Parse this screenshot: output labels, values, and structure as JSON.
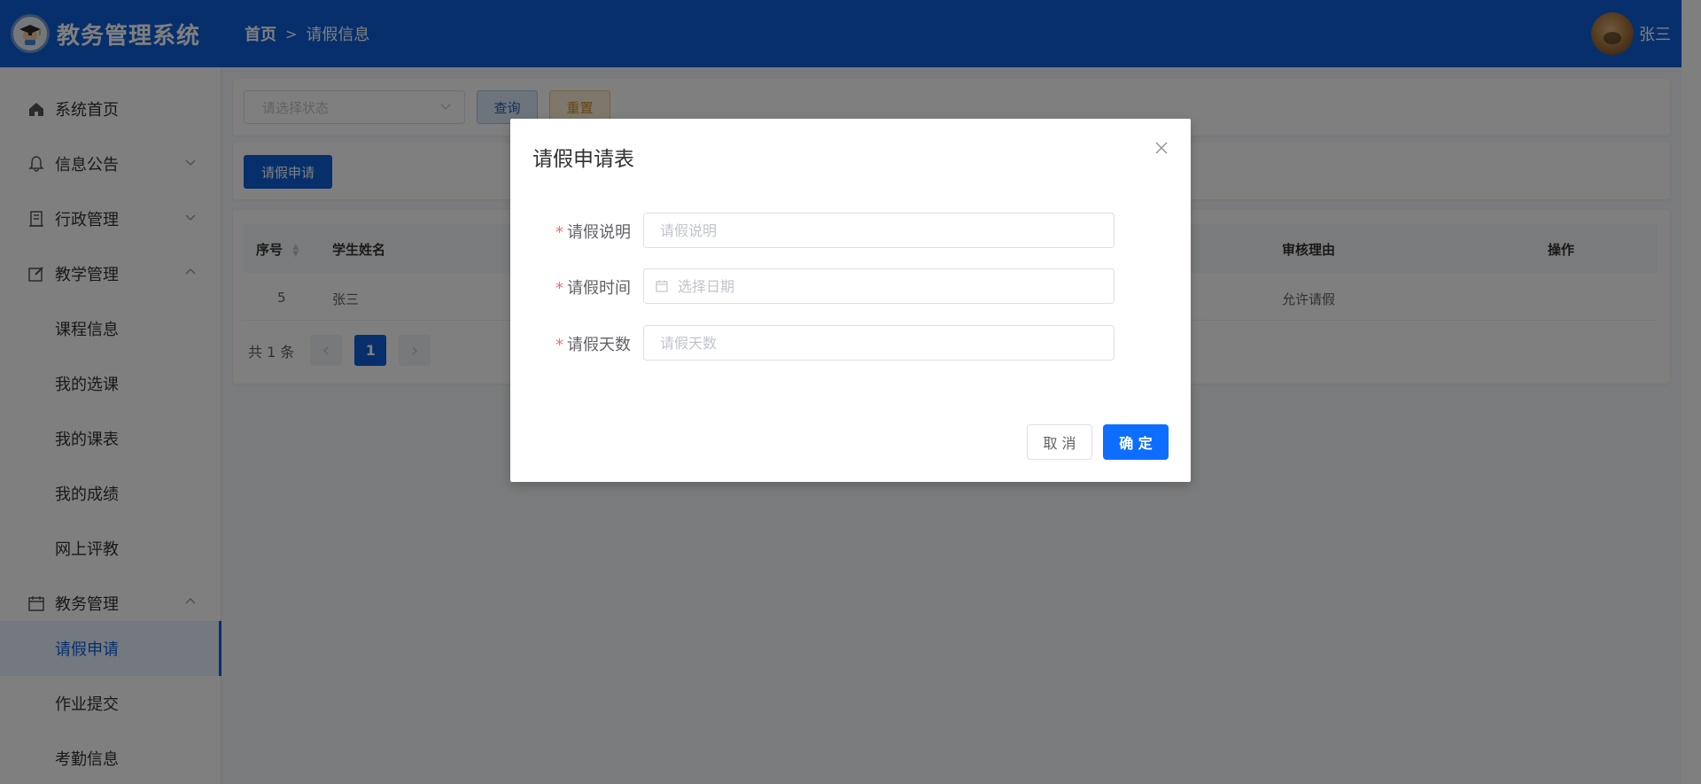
{
  "header": {
    "app_title": "教务管理系统",
    "breadcrumb_home": "首页",
    "breadcrumb_sep": ">",
    "breadcrumb_current": "请假信息",
    "username": "张三"
  },
  "sidebar": {
    "items": [
      {
        "label": "系统首页",
        "icon": "home-icon"
      },
      {
        "label": "信息公告",
        "icon": "bell-icon",
        "arrow": "down"
      },
      {
        "label": "行政管理",
        "icon": "building-icon",
        "arrow": "down"
      },
      {
        "label": "教学管理",
        "icon": "edit-icon",
        "arrow": "up"
      },
      {
        "label": "教务管理",
        "icon": "calendar-icon",
        "arrow": "up"
      }
    ],
    "sub_items": [
      {
        "label": "课程信息"
      },
      {
        "label": "我的选课"
      },
      {
        "label": "我的课表"
      },
      {
        "label": "我的成绩"
      },
      {
        "label": "网上评教"
      },
      {
        "label": "请假申请",
        "active": true
      },
      {
        "label": "作业提交"
      },
      {
        "label": "考勤信息"
      }
    ]
  },
  "filter": {
    "status_placeholder": "请选择状态",
    "query_label": "查询",
    "reset_label": "重置"
  },
  "toolbar": {
    "apply_label": "请假申请"
  },
  "table": {
    "headers": [
      "序号",
      "学生姓名",
      "审核理由",
      "操作"
    ],
    "rows": [
      {
        "index": "5",
        "student": "张三",
        "reason": "允许请假"
      }
    ]
  },
  "pagination": {
    "total_text": "共 1 条",
    "current_page": "1"
  },
  "dialog": {
    "title": "请假申请表",
    "fields": [
      {
        "label": "请假说明",
        "placeholder": "请假说明"
      },
      {
        "label": "请假时间",
        "placeholder": "选择日期"
      },
      {
        "label": "请假天数",
        "placeholder": "请假天数"
      }
    ],
    "required_mark": "*",
    "cancel_label": "取 消",
    "ok_label": "确 定"
  },
  "colors": {
    "primary": "#0c5fd9",
    "confirm": "#0d6efd",
    "required": "#f56c6c"
  }
}
